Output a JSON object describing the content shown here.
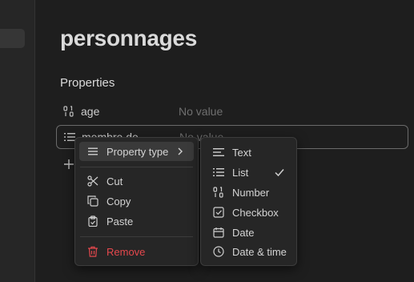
{
  "note": {
    "title": "personnages",
    "properties_heading": "Properties",
    "properties": [
      {
        "icon": "number-icon",
        "key": "age",
        "value": "No value"
      },
      {
        "icon": "list-icon",
        "key": "membre de",
        "value": "No value"
      }
    ]
  },
  "context_menu": {
    "property_type": "Property type",
    "cut": "Cut",
    "copy": "Copy",
    "paste": "Paste",
    "remove": "Remove"
  },
  "type_submenu": {
    "items": [
      "Text",
      "List",
      "Number",
      "Checkbox",
      "Date",
      "Date & time"
    ],
    "selected": "List"
  },
  "colors": {
    "danger": "#e5484d",
    "background": "#1e1e1e",
    "menu": "#262626"
  }
}
